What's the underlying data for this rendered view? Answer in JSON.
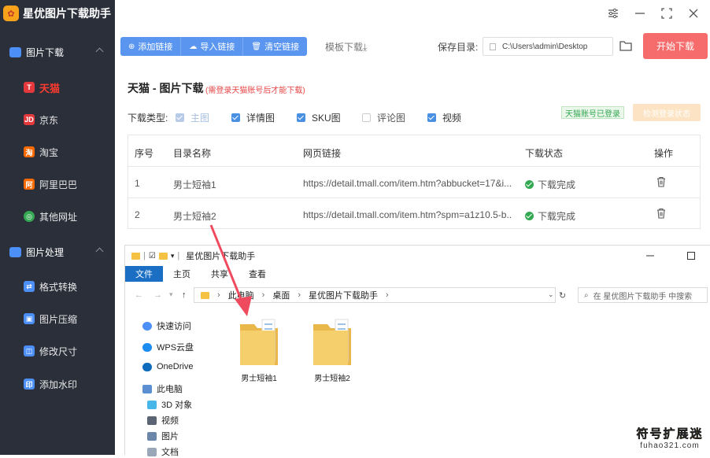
{
  "app": {
    "title": "星优图片下载助手",
    "logo_glyph": "✿"
  },
  "sidebar": {
    "group1": "图片下载",
    "items1": [
      {
        "label": "天猫",
        "badge": "T",
        "color": "#e4393c"
      },
      {
        "label": "京东",
        "badge": "JD",
        "color": "#e4393c"
      },
      {
        "label": "淘宝",
        "badge": "淘",
        "color": "#ff6a00"
      },
      {
        "label": "阿里巴巴",
        "badge": "阿",
        "color": "#ff6a00"
      },
      {
        "label": "其他网址",
        "badge": "◎",
        "color": "#34a853"
      }
    ],
    "group2": "图片处理",
    "items2": [
      {
        "label": "格式转换",
        "badge": "⇄",
        "color": "#4b8ff7"
      },
      {
        "label": "图片压缩",
        "badge": "▣",
        "color": "#4b8ff7"
      },
      {
        "label": "修改尺寸",
        "badge": "◫",
        "color": "#4b8ff7"
      },
      {
        "label": "添加水印",
        "badge": "印",
        "color": "#4b8ff7"
      }
    ]
  },
  "toolbar": {
    "add": "添加链接",
    "import": "导入链接",
    "clear": "清空链接",
    "template": "模板下载",
    "template_icon": "⤓"
  },
  "save": {
    "label": "保存目录:",
    "path": "C:\\Users\\admin\\Desktop",
    "start": "开始下载"
  },
  "page": {
    "title": "天猫 - 图片下载",
    "note": "(需登录天猫账号后才能下载)"
  },
  "download_type": {
    "label": "下载类型:",
    "options": [
      {
        "label": "主图",
        "checked": true,
        "disabled": true
      },
      {
        "label": "详情图",
        "checked": true
      },
      {
        "label": "SKU图",
        "checked": true
      },
      {
        "label": "评论图",
        "checked": false
      },
      {
        "label": "视频",
        "checked": true
      }
    ],
    "logged_in": "天猫账号已登录",
    "check_login": "检测登录状态"
  },
  "table": {
    "headers": [
      "序号",
      "目录名称",
      "网页链接",
      "下载状态",
      "操作"
    ],
    "rows": [
      {
        "no": "1",
        "name": "男士短袖1",
        "url": "https://detail.tmall.com/item.htm?abbucket=17&i...",
        "status": "下载完成"
      },
      {
        "no": "2",
        "name": "男士短袖2",
        "url": "https://detail.tmall.com/item.htm?spm=a1z10.5-b...",
        "status": "下载完成"
      }
    ]
  },
  "explorer": {
    "title": "星优图片下载助手",
    "tabs": [
      "文件",
      "主页",
      "共享",
      "查看"
    ],
    "path": [
      "此电脑",
      "桌面",
      "星优图片下载助手"
    ],
    "search_placeholder": "在 星优图片下载助手 中搜索",
    "nav": [
      "快速访问",
      "WPS云盘",
      "OneDrive",
      "此电脑",
      "3D 对象",
      "视频",
      "图片",
      "文档"
    ],
    "files": [
      "男士短袖1",
      "男士短袖2"
    ]
  },
  "watermark": {
    "line1": "符号扩展迷",
    "line2": "fuhao321.com"
  }
}
